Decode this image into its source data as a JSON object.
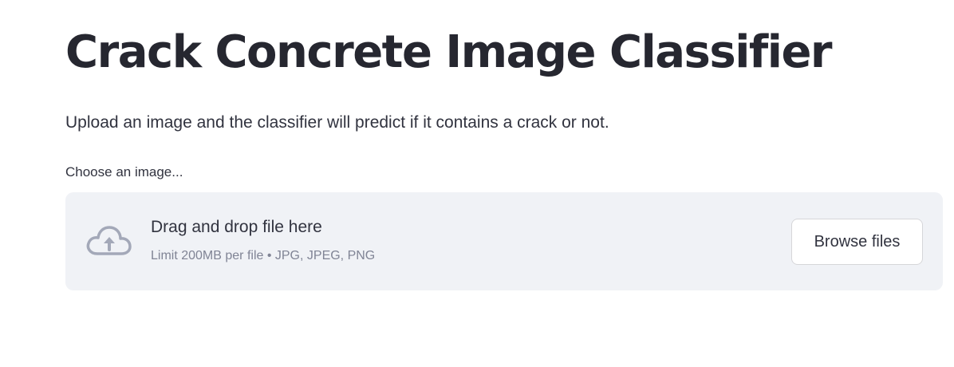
{
  "page": {
    "title": "Crack Concrete Image Classifier",
    "description": "Upload an image and the classifier will predict if it contains a crack or not."
  },
  "uploader": {
    "label": "Choose an image...",
    "drop_text": "Drag and drop file here",
    "limit_text": "Limit 200MB per file • JPG, JPEG, PNG",
    "browse_label": "Browse files",
    "icon": "cloud-upload-icon"
  },
  "colors": {
    "title": "#262730",
    "text": "#31333f",
    "muted": "#808495",
    "dropzone_bg": "#f0f2f6",
    "icon": "#a3a8b8"
  }
}
